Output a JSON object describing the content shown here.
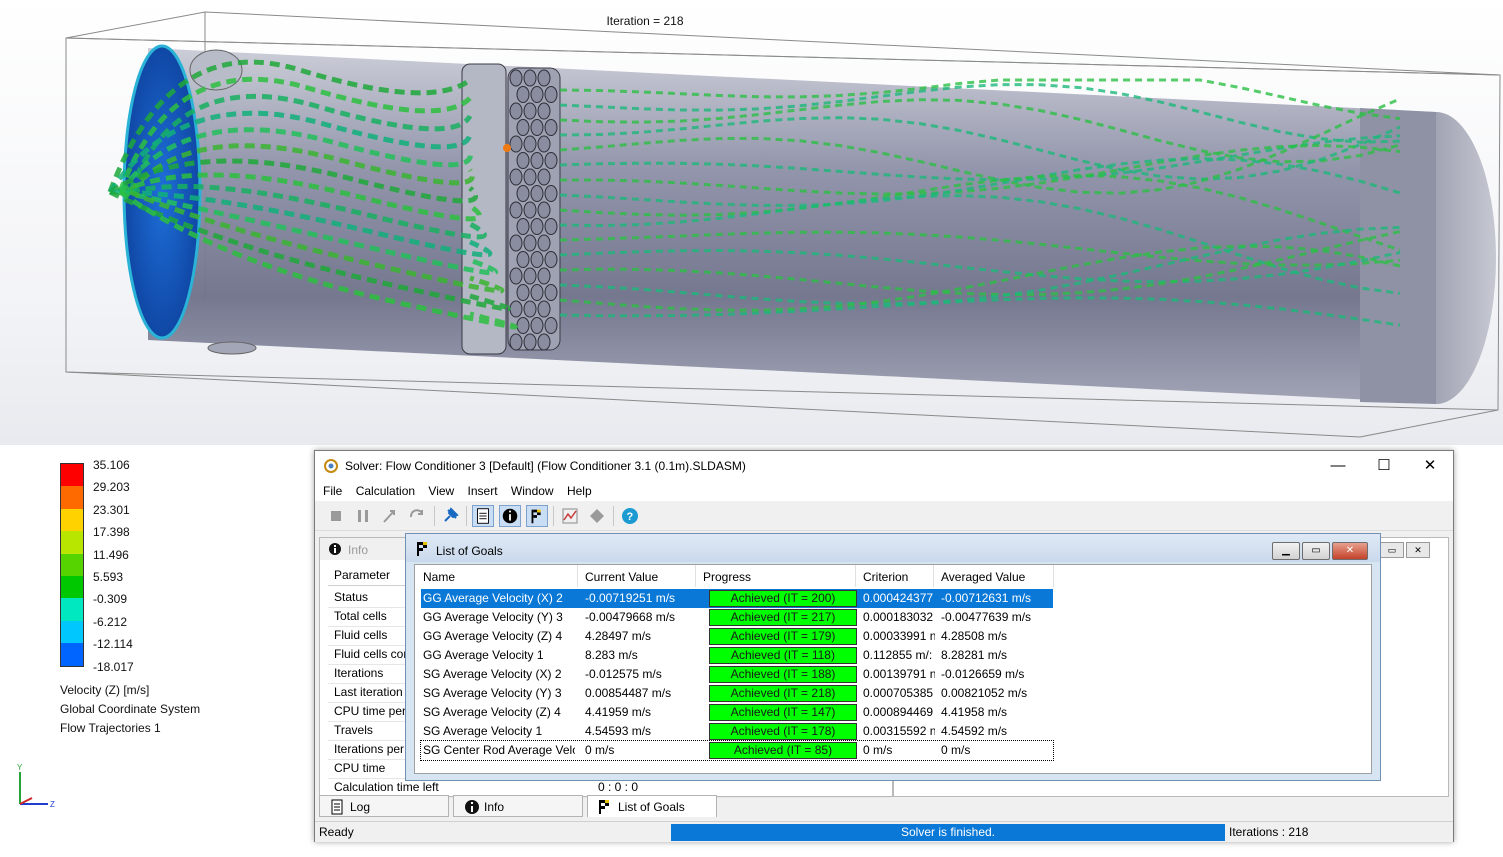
{
  "viewport": {
    "iteration_label": "Iteration = 218"
  },
  "legend": {
    "values": [
      "35.106",
      "29.203",
      "23.301",
      "17.398",
      "11.496",
      "5.593",
      "-0.309",
      "-6.212",
      "-12.114",
      "-18.017"
    ],
    "colors": [
      "#ff0000",
      "#ff6a00",
      "#ffd200",
      "#b8e600",
      "#55d400",
      "#00c800",
      "#00e8c0",
      "#00c8ff",
      "#0064ff",
      "#1400e6"
    ],
    "parameter": "Velocity (Z) [m/s]",
    "coordinate_system": "Global Coordinate System",
    "trajectories": "Flow Trajectories 1"
  },
  "solver": {
    "title": "Solver: Flow Conditioner 3 [Default] (Flow Conditioner 3.1 (0.1m).SLDASM)",
    "window_buttons": [
      "—",
      "☐",
      "✕"
    ],
    "menu": [
      "File",
      "Calculation",
      "View",
      "Insert",
      "Window",
      "Help"
    ],
    "info_panel": {
      "title": "Info",
      "column_header": "Parameter",
      "rows": [
        "Status",
        "Total cells",
        "Fluid cells",
        "Fluid cells con",
        "Iterations",
        "Last iteration",
        "CPU time per",
        "Travels",
        "Iterations per",
        "CPU time",
        "Calculation time left"
      ],
      "time_left_value": "0 : 0 : 0"
    },
    "goals": {
      "title": "List of Goals",
      "columns": [
        "Name",
        "Current Value",
        "Progress",
        "Criterion",
        "Averaged Value"
      ],
      "rows": [
        {
          "name": "GG Average Velocity (X) 2",
          "current": "-0.00719251 m/s",
          "progress": "Achieved (IT = 200)",
          "progress_fraction": 1.0,
          "criterion": "0.000424377",
          "averaged": "-0.00712631 m/s"
        },
        {
          "name": "GG Average Velocity (Y) 3",
          "current": "-0.00479668 m/s",
          "progress": "Achieved (IT = 217)",
          "progress_fraction": 1.0,
          "criterion": "0.000183032",
          "averaged": "-0.00477639 m/s"
        },
        {
          "name": "GG Average Velocity (Z) 4",
          "current": "4.28497 m/s",
          "progress": "Achieved (IT = 179)",
          "progress_fraction": 1.0,
          "criterion": "0.00033991 n",
          "averaged": "4.28508 m/s"
        },
        {
          "name": "GG Average Velocity 1",
          "current": "8.283 m/s",
          "progress": "Achieved (IT = 118)",
          "progress_fraction": 1.0,
          "criterion": "0.112855 m/:",
          "averaged": "8.28281 m/s"
        },
        {
          "name": "SG Average Velocity (X) 2",
          "current": "-0.012575 m/s",
          "progress": "Achieved (IT = 188)",
          "progress_fraction": 1.0,
          "criterion": "0.00139791 n",
          "averaged": "-0.0126659 m/s"
        },
        {
          "name": "SG Average Velocity (Y) 3",
          "current": "0.00854487 m/s",
          "progress": "Achieved (IT = 218)",
          "progress_fraction": 1.0,
          "criterion": "0.000705385",
          "averaged": "0.00821052 m/s"
        },
        {
          "name": "SG Average Velocity (Z) 4",
          "current": "4.41959 m/s",
          "progress": "Achieved (IT = 147)",
          "progress_fraction": 1.0,
          "criterion": "0.000894469",
          "averaged": "4.41958 m/s"
        },
        {
          "name": "SG Average Velocity 1",
          "current": "4.54593 m/s",
          "progress": "Achieved (IT = 178)",
          "progress_fraction": 1.0,
          "criterion": "0.00315592 n",
          "averaged": "4.54592 m/s"
        },
        {
          "name": "SG Center Rod Average Veloc",
          "current": "0 m/s",
          "progress": "Achieved (IT = 85)",
          "progress_fraction": 1.0,
          "criterion": "0 m/s",
          "averaged": "0 m/s"
        }
      ]
    },
    "tabs": [
      "Log",
      "Info",
      "List of Goals"
    ],
    "status": {
      "ready": "Ready",
      "progress_text": "Solver is finished.",
      "iterations": "Iterations : 218"
    },
    "colors": {
      "selection": "#0a78d7",
      "achieved": "#00ff00"
    }
  }
}
